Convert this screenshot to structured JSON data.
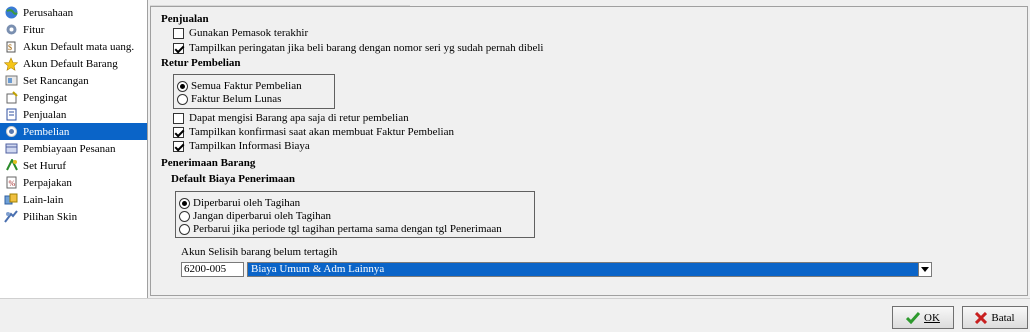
{
  "sidebar": {
    "items": [
      {
        "label": "Perusahaan",
        "icon": "globe-icon"
      },
      {
        "label": "Fitur",
        "icon": "gear-icon"
      },
      {
        "label": "Akun Default mata uang.",
        "icon": "currency-icon"
      },
      {
        "label": "Akun Default Barang",
        "icon": "star-icon"
      },
      {
        "label": "Set Rancangan",
        "icon": "layout-icon"
      },
      {
        "label": "Pengingat",
        "icon": "reminder-icon"
      },
      {
        "label": "Penjualan",
        "icon": "sales-icon"
      },
      {
        "label": "Pembelian",
        "icon": "purchase-icon"
      },
      {
        "label": "Pembiayaan Pesanan",
        "icon": "finance-icon"
      },
      {
        "label": "Set Huruf",
        "icon": "font-icon"
      },
      {
        "label": "Perpajakan",
        "icon": "tax-icon"
      },
      {
        "label": "Lain-lain",
        "icon": "misc-icon"
      },
      {
        "label": "Pilihan Skin",
        "icon": "skin-icon"
      }
    ],
    "selected": "Pembelian"
  },
  "penjualan": {
    "title": "Penjualan",
    "gunakan_pemasok": "Gunakan Pemasok terakhir",
    "tampilkan_peringatan": "Tampilkan peringatan jika beli barang dengan nomor seri yg sudah pernah dibeli"
  },
  "retur": {
    "title": "Retur Pembelian",
    "radio_semua": "Semua Faktur Pembelian",
    "radio_belum": "Faktur Belum Lunas",
    "dapat_mengisi": "Dapat mengisi Barang apa saja di retur pembelian",
    "tampilkan_konfirmasi": "Tampilkan konfirmasi saat akan membuat Faktur Pembelian",
    "tampilkan_biaya": "Tampilkan Informasi Biaya"
  },
  "penerimaan": {
    "title": "Penerimaan Barang",
    "default_biaya": "Default Biaya Penerimaan",
    "radio_diperbarui": "Diperbarui oleh Tagihan",
    "radio_jangan": "Jangan diperbarui oleh Tagihan",
    "radio_perbarui_jika": "Perbarui jika periode tgl tagihan pertama sama dengan tgl Penerimaan",
    "akun_label": "Akun Selisih barang belum tertagih",
    "akun_code": "6200-005",
    "akun_name": "Biaya Umum & Adm Lainnya"
  },
  "footer": {
    "ok_label": "OK",
    "batal_label": "Batal"
  },
  "colors": {
    "selection": "#0a64c8",
    "ok_check": "#2e9a2e",
    "cancel_x": "#c82020"
  }
}
